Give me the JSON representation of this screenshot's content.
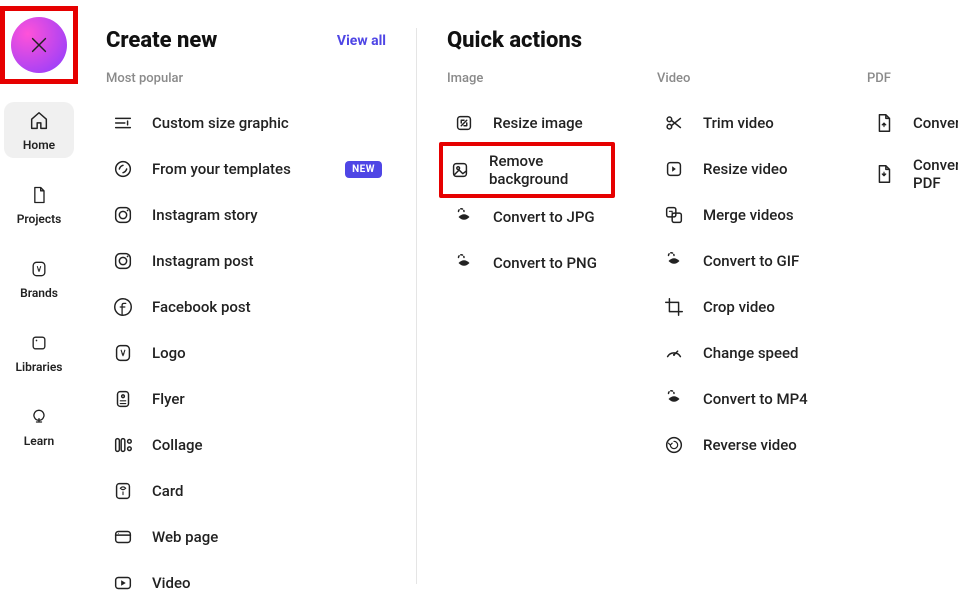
{
  "sidebar": {
    "items": [
      {
        "label": "Home"
      },
      {
        "label": "Projects"
      },
      {
        "label": "Brands"
      },
      {
        "label": "Libraries"
      },
      {
        "label": "Learn"
      }
    ]
  },
  "create": {
    "title": "Create new",
    "view_all": "View all",
    "subhead": "Most popular",
    "badge_new": "NEW",
    "items": [
      {
        "label": "Custom size graphic"
      },
      {
        "label": "From your templates"
      },
      {
        "label": "Instagram story"
      },
      {
        "label": "Instagram post"
      },
      {
        "label": "Facebook post"
      },
      {
        "label": "Logo"
      },
      {
        "label": "Flyer"
      },
      {
        "label": "Collage"
      },
      {
        "label": "Card"
      },
      {
        "label": "Web page"
      },
      {
        "label": "Video"
      }
    ]
  },
  "quick": {
    "title": "Quick actions",
    "image": {
      "subhead": "Image",
      "items": [
        {
          "label": "Resize image"
        },
        {
          "label": "Remove background"
        },
        {
          "label": "Convert to JPG"
        },
        {
          "label": "Convert to PNG"
        }
      ]
    },
    "video": {
      "subhead": "Video",
      "items": [
        {
          "label": "Trim video"
        },
        {
          "label": "Resize video"
        },
        {
          "label": "Merge videos"
        },
        {
          "label": "Convert to GIF"
        },
        {
          "label": "Crop video"
        },
        {
          "label": "Change speed"
        },
        {
          "label": "Convert to MP4"
        },
        {
          "label": "Reverse video"
        }
      ]
    },
    "pdf": {
      "subhead": "PDF",
      "items": [
        {
          "label": "Convert to PDF"
        },
        {
          "label": "Convert from PDF"
        }
      ]
    }
  }
}
